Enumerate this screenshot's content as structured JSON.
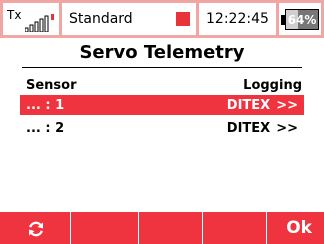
{
  "status_bar": {
    "tx_label": "Tx",
    "model_name": "Standard",
    "time": "12:22:45",
    "battery_text": "64%",
    "battery_level": 0.64,
    "icons": [
      "signal-bars-icon",
      "record-indicator-icon",
      "battery-icon"
    ]
  },
  "title": "Servo Telemetry",
  "columns": {
    "sensor": "Sensor",
    "logging": "Logging"
  },
  "rows": [
    {
      "sensor": "... : 1",
      "logging": "DITEX",
      "arrow": ">>",
      "selected": true
    },
    {
      "sensor": "... : 2",
      "logging": "DITEX",
      "arrow": ">>",
      "selected": false
    }
  ],
  "footer": {
    "refresh_icon": "refresh-icon",
    "ok_label": "Ok"
  },
  "colors": {
    "accent_red": "#f0343f",
    "status_bar_bg": "#f2a6a3"
  }
}
